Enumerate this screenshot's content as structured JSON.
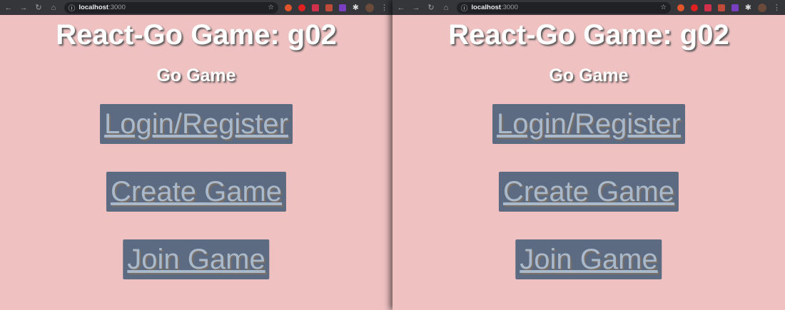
{
  "windows": [
    {
      "url_host": "localhost",
      "url_port": ":3000",
      "title": "React-Go Game: g02",
      "subtitle": "Go Game",
      "buttons": [
        "Login/Register",
        "Create Game",
        "Join Game"
      ]
    },
    {
      "url_host": "localhost",
      "url_port": ":3000",
      "title": "React-Go Game: g02",
      "subtitle": "Go Game",
      "buttons": [
        "Login/Register",
        "Create Game",
        "Join Game"
      ]
    }
  ],
  "colors": {
    "background": "#efc1c1",
    "button": "#5d6b82",
    "button_text": "#a9b9cc"
  }
}
